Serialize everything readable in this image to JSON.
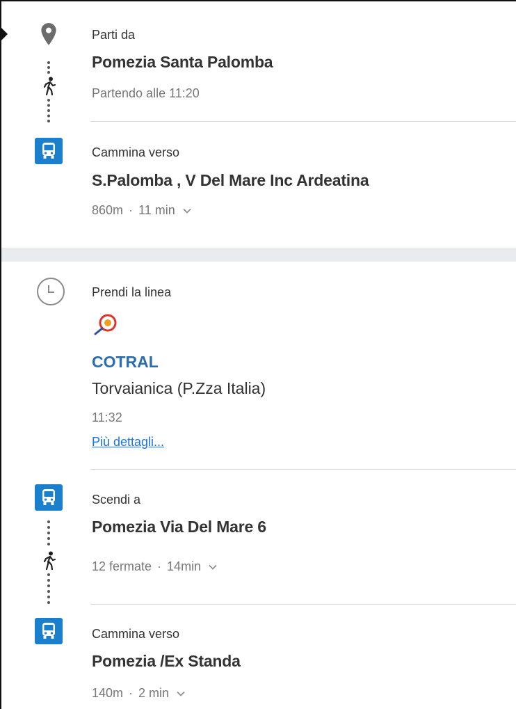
{
  "colors": {
    "accent_blue": "#1a7fcd",
    "line_blue": "#2a6db0",
    "link_blue": "#1a73e8",
    "cotral_red": "#e0342b"
  },
  "start": {
    "label": "Parti da",
    "title": "Pomezia Santa Palomba",
    "meta": "Partendo alle 11:20"
  },
  "walk1": {
    "label": "Cammina verso",
    "title": "S.Palomba , V Del Mare Inc Ardeatina",
    "distance": "860m",
    "duration": "11 min"
  },
  "ride": {
    "label": "Prendi la linea",
    "operator": "COTRAL",
    "destination": "Torvaianica (P.Zza Italia)",
    "time": "11:32",
    "details_link": "Più dettagli..."
  },
  "alight": {
    "label": "Scendi a",
    "title": "Pomezia Via Del Mare 6",
    "stops": "12 fermate",
    "duration": "14min"
  },
  "walk2": {
    "label": "Cammina verso",
    "title": "Pomezia /Ex Standa",
    "distance": "140m",
    "duration": "2 min"
  },
  "separator": "·"
}
